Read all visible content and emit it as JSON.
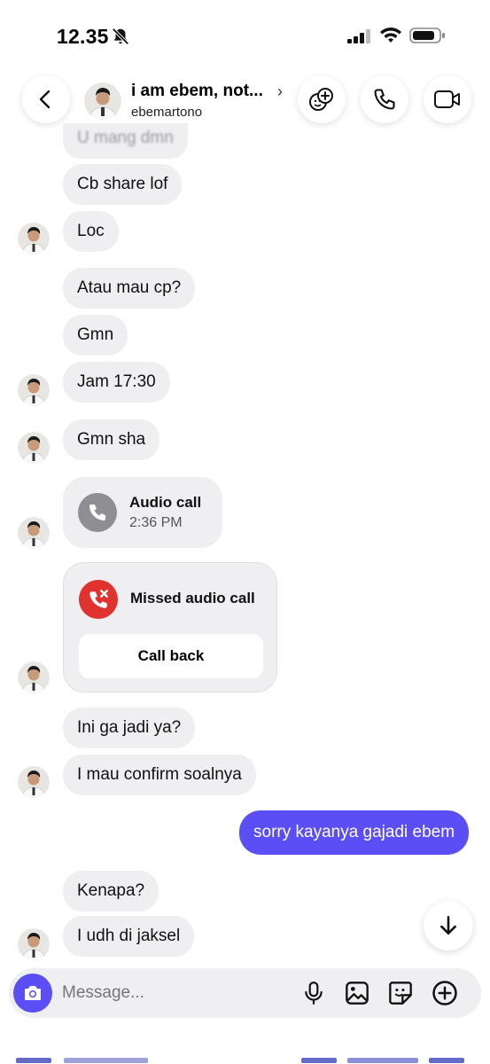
{
  "status_bar": {
    "time": "12.35"
  },
  "header": {
    "name": "i am ebem, not...",
    "username": "ebemartono"
  },
  "messages": [
    {
      "text": "U mang dmn"
    },
    {
      "text": "Cb share lof"
    },
    {
      "text": "Loc"
    },
    {
      "text": "Atau mau cp?"
    },
    {
      "text": "Gmn"
    },
    {
      "text": "Jam 17:30"
    },
    {
      "text": "Gmn sha"
    },
    {
      "text": "Ini ga jadi ya?"
    },
    {
      "text": "I mau confirm soalnya"
    },
    {
      "text": "sorry kayanya gajadi ebem"
    },
    {
      "text": "Kenapa?"
    },
    {
      "text": "I udh di jaksel"
    }
  ],
  "audio_call": {
    "title": "Audio call",
    "time": "2:36 PM"
  },
  "missed_call": {
    "title": "Missed audio call",
    "button": "Call back"
  },
  "composer": {
    "placeholder": "Message..."
  },
  "colors": {
    "accent": "#5b4ef5",
    "bubble": "#efeff2",
    "missed": "#e0322e"
  },
  "icons": [
    "back-arrow",
    "effects",
    "phone",
    "video-camera",
    "arrow-down",
    "camera",
    "microphone",
    "gallery",
    "sticker",
    "plus"
  ]
}
